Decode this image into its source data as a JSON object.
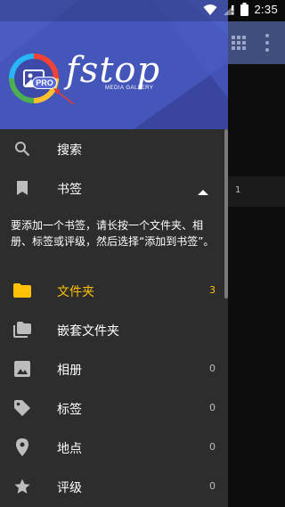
{
  "status_bar": {
    "time": "2:35"
  },
  "header": {
    "brand": "fstop",
    "brand_sub": "MEDIA GALLERY",
    "pro_label": "PRO"
  },
  "menu": {
    "search": {
      "label": "搜索"
    },
    "bookmarks": {
      "label": "书签"
    },
    "bookmark_hint": "要添加一个书签，请长按一个文件夹、相册、标签或评级，然后选择“添加到书签”。",
    "folders": {
      "label": "文件夹",
      "count": "3"
    },
    "nested_folders": {
      "label": "嵌套文件夹"
    },
    "albums": {
      "label": "相册",
      "count": "0"
    },
    "tags": {
      "label": "标签",
      "count": "0"
    },
    "places": {
      "label": "地点",
      "count": "0"
    },
    "ratings": {
      "label": "评级",
      "count": "0"
    }
  },
  "background": {
    "row_count": "1"
  },
  "colors": {
    "accent": "#ffc107",
    "header": "#3d4aa8",
    "drawer": "#2d2d2d",
    "appbar": "#3f4e7d"
  }
}
